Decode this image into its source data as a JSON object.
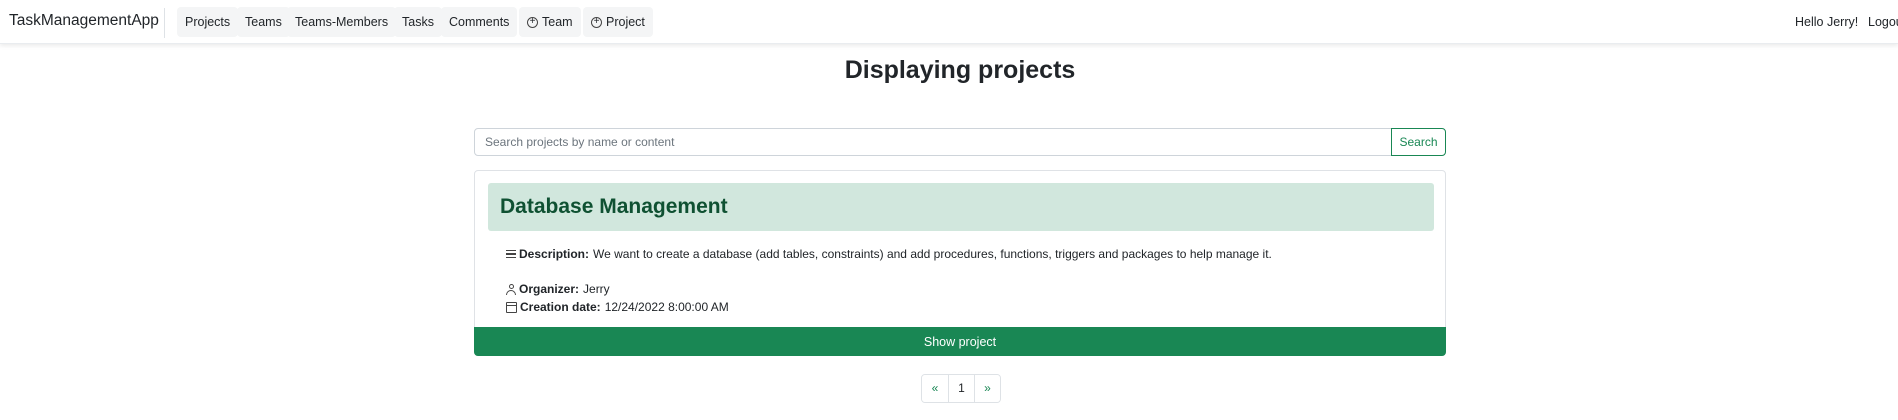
{
  "navbar": {
    "brand": "TaskManagementApp",
    "items": [
      {
        "label": "Projects"
      },
      {
        "label": "Teams"
      },
      {
        "label": "Teams-Members"
      },
      {
        "label": "Tasks"
      },
      {
        "label": "Comments"
      },
      {
        "label": "Team",
        "icon": "plus-circle-icon"
      },
      {
        "label": "Project",
        "icon": "plus-circle-icon"
      }
    ],
    "greeting": "Hello Jerry!",
    "logout": "Logout"
  },
  "page": {
    "title": "Displaying projects"
  },
  "search": {
    "placeholder": "Search projects by name or content",
    "value": "",
    "button_label": "Search"
  },
  "project": {
    "name": "Database Management",
    "description_label": "Description:",
    "description": "We want to create a database (add tables, constraints) and add procedures, functions, triggers and packages to help manage it.",
    "organizer_label": "Organizer:",
    "organizer": "Jerry",
    "creation_label": "Creation date:",
    "creation_date": "12/24/2022 8:00:00 AM",
    "show_label": "Show project"
  },
  "pagination": {
    "prev": "«",
    "pages": [
      "1"
    ],
    "next": "»"
  },
  "colors": {
    "accent": "#198754",
    "header_bg": "#d1e7dd",
    "header_text": "#0f5132"
  }
}
